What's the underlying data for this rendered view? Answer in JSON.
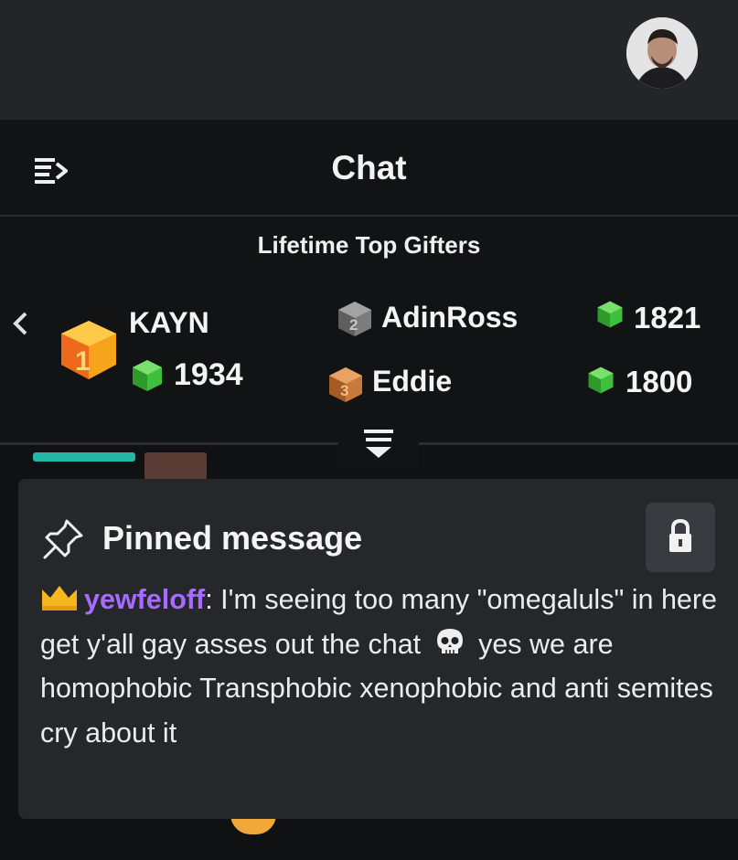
{
  "header": {
    "avatar_icon": "user-avatar"
  },
  "chat": {
    "title": "Chat",
    "collapse_icon": "collapse-sidebar-icon"
  },
  "gifters": {
    "title": "Lifetime Top Gifters",
    "prev_icon": "chevron-left-icon",
    "entries": [
      {
        "rank": "1",
        "name": "KAYN",
        "amount": "1934"
      },
      {
        "rank": "2",
        "name": "AdinRoss",
        "amount": "1821"
      },
      {
        "rank": "3",
        "name": "Eddie",
        "amount": "1800"
      }
    ],
    "colors": {
      "gem": "#3fbf3b",
      "rank1": "#f7a41d",
      "rank2": "#8a8a8a",
      "rank3": "#c97a3a"
    }
  },
  "pinned": {
    "title": "Pinned message",
    "username": "yewfeloff",
    "separator": ":",
    "message_part1": " I'm seeing too many \"omegaluls\" in here get y'all gay asses out the chat ",
    "message_part2": " yes we are homophobic Transphobic xenophobic and anti semites cry about it",
    "username_color": "#a76cff",
    "badge_icon": "crown-icon",
    "emoji_icon": "skull-emoji-icon",
    "lock_icon": "lock-icon"
  }
}
